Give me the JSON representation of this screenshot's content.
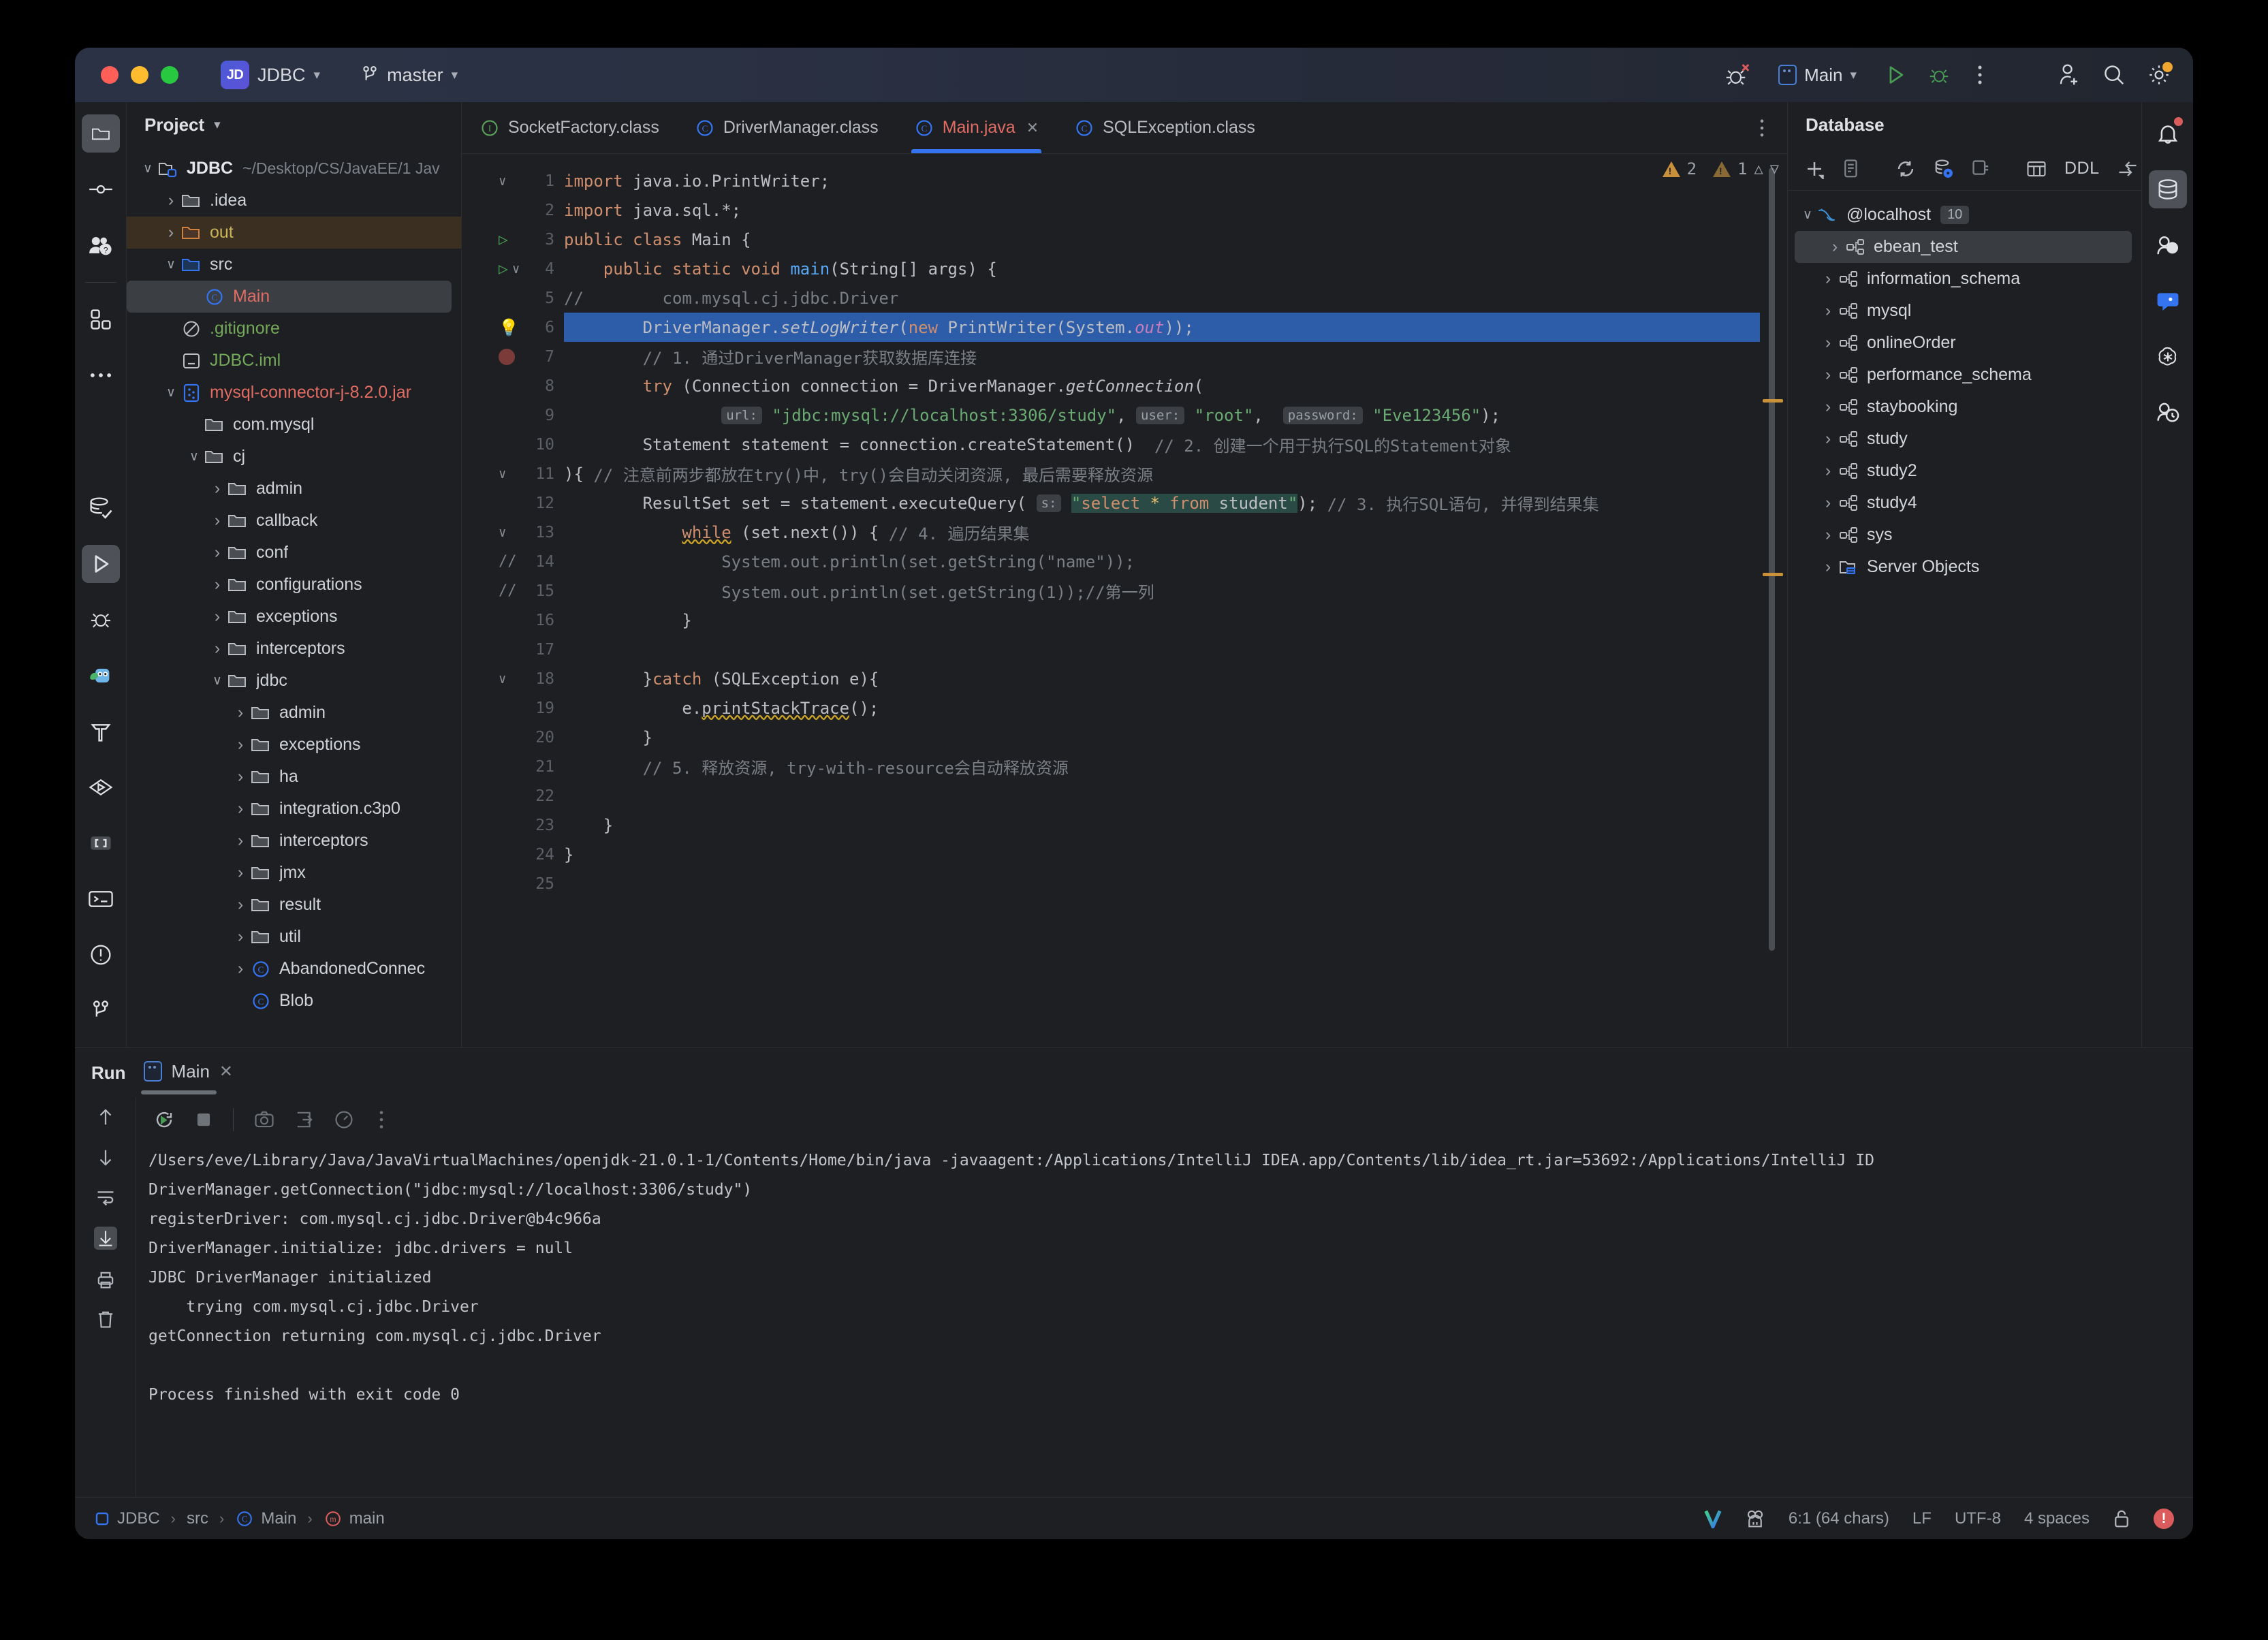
{
  "window": {
    "traffic": [
      "close",
      "minimize",
      "maximize"
    ],
    "project_badge": "JD",
    "project_name": "JDBC",
    "branch": "master",
    "run_config": "Main"
  },
  "activity_bar_left": [
    {
      "name": "project-icon",
      "label": "Project",
      "selected": true
    },
    {
      "name": "commit-icon",
      "label": "Commit"
    },
    {
      "name": "pull-requests-icon",
      "label": "Pull Requests"
    },
    {
      "name": "structure-icon",
      "label": "Structure"
    },
    {
      "name": "more-tool-windows-icon",
      "label": "More"
    }
  ],
  "activity_bar_left_bottom": [
    {
      "name": "database-check-icon",
      "label": "Database Changes"
    },
    {
      "name": "run-icon",
      "label": "Run",
      "selected": true
    },
    {
      "name": "debug-icon",
      "label": "Debug"
    },
    {
      "name": "ai-assistant-icon",
      "label": "AI Assistant"
    },
    {
      "name": "build-icon",
      "label": "Build"
    },
    {
      "name": "services-icon",
      "label": "Services"
    },
    {
      "name": "dependencies-icon",
      "label": "Dependencies"
    },
    {
      "name": "terminal-icon",
      "label": "Terminal"
    },
    {
      "name": "problems-icon",
      "label": "Problems"
    },
    {
      "name": "version-control-icon",
      "label": "Version Control"
    }
  ],
  "activity_bar_right": [
    {
      "name": "notifications-icon",
      "label": "Notifications",
      "dot": true
    },
    {
      "name": "database-icon",
      "label": "Database",
      "selected": true
    },
    {
      "name": "ai-chat-icon",
      "label": "AI Chat"
    },
    {
      "name": "assistant-icon",
      "label": "Assistant"
    },
    {
      "name": "openai-icon",
      "label": "OpenAI"
    },
    {
      "name": "profiler-icon",
      "label": "Profiler"
    }
  ],
  "project_panel": {
    "title": "Project",
    "items": [
      {
        "depth": 0,
        "arrow": "open",
        "icon": "module-folder",
        "label": "JDBC",
        "suffix": "~/Desktop/CS/JavaEE/1 Jav",
        "bold": true
      },
      {
        "depth": 1,
        "arrow": "closed",
        "icon": "folder",
        "label": ".idea"
      },
      {
        "depth": 1,
        "arrow": "closed",
        "icon": "folder-excluded",
        "label": "out",
        "color": "yellow",
        "highlight": true
      },
      {
        "depth": 1,
        "arrow": "open",
        "icon": "folder-source",
        "label": "src"
      },
      {
        "depth": 2,
        "arrow": "none",
        "icon": "class",
        "label": "Main",
        "color": "red",
        "selected": true
      },
      {
        "depth": 1,
        "arrow": "none",
        "icon": "gitignore",
        "label": ".gitignore",
        "color": "green"
      },
      {
        "depth": 1,
        "arrow": "none",
        "icon": "iml",
        "label": "JDBC.iml",
        "color": "green"
      },
      {
        "depth": 1,
        "arrow": "open",
        "icon": "jar",
        "label": "mysql-connector-j-8.2.0.jar",
        "color": "red"
      },
      {
        "depth": 2,
        "arrow": "none",
        "icon": "folder",
        "label": "com.mysql"
      },
      {
        "depth": 2,
        "arrow": "open",
        "icon": "folder",
        "label": "cj"
      },
      {
        "depth": 3,
        "arrow": "closed",
        "icon": "folder",
        "label": "admin"
      },
      {
        "depth": 3,
        "arrow": "closed",
        "icon": "folder",
        "label": "callback"
      },
      {
        "depth": 3,
        "arrow": "closed",
        "icon": "folder",
        "label": "conf"
      },
      {
        "depth": 3,
        "arrow": "closed",
        "icon": "folder",
        "label": "configurations"
      },
      {
        "depth": 3,
        "arrow": "closed",
        "icon": "folder",
        "label": "exceptions"
      },
      {
        "depth": 3,
        "arrow": "closed",
        "icon": "folder",
        "label": "interceptors"
      },
      {
        "depth": 3,
        "arrow": "open",
        "icon": "folder",
        "label": "jdbc"
      },
      {
        "depth": 4,
        "arrow": "closed",
        "icon": "folder",
        "label": "admin"
      },
      {
        "depth": 4,
        "arrow": "closed",
        "icon": "folder",
        "label": "exceptions"
      },
      {
        "depth": 4,
        "arrow": "closed",
        "icon": "folder",
        "label": "ha"
      },
      {
        "depth": 4,
        "arrow": "closed",
        "icon": "folder",
        "label": "integration.c3p0"
      },
      {
        "depth": 4,
        "arrow": "closed",
        "icon": "folder",
        "label": "interceptors"
      },
      {
        "depth": 4,
        "arrow": "closed",
        "icon": "folder",
        "label": "jmx"
      },
      {
        "depth": 4,
        "arrow": "closed",
        "icon": "folder",
        "label": "result"
      },
      {
        "depth": 4,
        "arrow": "closed",
        "icon": "folder",
        "label": "util"
      },
      {
        "depth": 4,
        "arrow": "closed",
        "icon": "class",
        "label": "AbandonedConnec"
      },
      {
        "depth": 4,
        "arrow": "none",
        "icon": "class",
        "label": "Blob"
      }
    ]
  },
  "editor": {
    "tabs": [
      {
        "label": "SocketFactory.class",
        "icon": "interface",
        "active": false
      },
      {
        "label": "DriverManager.class",
        "icon": "class",
        "active": false
      },
      {
        "label": "Main.java",
        "icon": "class",
        "active": true,
        "closable": true
      },
      {
        "label": "SQLException.class",
        "icon": "class",
        "active": false
      }
    ],
    "inspections": {
      "warnings": "2",
      "weak_warnings": "1"
    },
    "lines": [
      {
        "n": "1",
        "fold": "open",
        "code": [
          {
            "t": "import",
            "c": "kw"
          },
          {
            "t": " java.io.PrintWriter;",
            "c": "white"
          }
        ]
      },
      {
        "n": "2",
        "code": [
          {
            "t": "import",
            "c": "kw"
          },
          {
            "t": " java.sql.*;",
            "c": "white"
          }
        ]
      },
      {
        "n": "3",
        "run": true,
        "code": [
          {
            "t": "public class",
            "c": "kw"
          },
          {
            "t": " Main {",
            "c": "white"
          }
        ]
      },
      {
        "n": "4",
        "run": true,
        "fold": "open",
        "code": [
          {
            "t": "    ",
            "c": "white"
          },
          {
            "t": "public static void",
            "c": "kw"
          },
          {
            "t": " ",
            "c": "white"
          },
          {
            "t": "main",
            "c": "meth"
          },
          {
            "t": "(String[] args) {",
            "c": "white"
          }
        ]
      },
      {
        "n": "5",
        "code": [
          {
            "t": "//        com.mysql.cj.jdbc.Driver",
            "c": "cmt"
          }
        ]
      },
      {
        "n": "6",
        "bulb": true,
        "highlight": true,
        "code": [
          {
            "t": "        DriverManager.",
            "c": "white"
          },
          {
            "t": "setLogWriter",
            "c": "ital"
          },
          {
            "t": "(",
            "c": "white"
          },
          {
            "t": "new",
            "c": "kw"
          },
          {
            "t": " PrintWriter(System.",
            "c": "white"
          },
          {
            "t": "out",
            "c": "field ital"
          },
          {
            "t": "));",
            "c": "white"
          }
        ]
      },
      {
        "n": "7",
        "breakpoint": true,
        "code": [
          {
            "t": "        // 1. 通过DriverManager获取数据库连接",
            "c": "cmt"
          }
        ]
      },
      {
        "n": "8",
        "code": [
          {
            "t": "        ",
            "c": "white"
          },
          {
            "t": "try",
            "c": "kw"
          },
          {
            "t": " (Connection connection = DriverManager.",
            "c": "white"
          },
          {
            "t": "getConnection",
            "c": "ital"
          },
          {
            "t": "(",
            "c": "white"
          }
        ]
      },
      {
        "n": "9",
        "code": [
          {
            "t": "                ",
            "c": "white"
          },
          {
            "t": "url:",
            "c": "hint"
          },
          {
            "t": " ",
            "c": "white"
          },
          {
            "t": "\"jdbc:mysql://localhost:3306/study\"",
            "c": "str"
          },
          {
            "t": ", ",
            "c": "white"
          },
          {
            "t": "user:",
            "c": "hint"
          },
          {
            "t": " ",
            "c": "white"
          },
          {
            "t": "\"root\"",
            "c": "str"
          },
          {
            "t": ",  ",
            "c": "white"
          },
          {
            "t": "password:",
            "c": "hint"
          },
          {
            "t": " ",
            "c": "white"
          },
          {
            "t": "\"Eve123456\"",
            "c": "str"
          },
          {
            "t": ");",
            "c": "white"
          }
        ]
      },
      {
        "n": "10",
        "code": [
          {
            "t": "        Statement statement = connection.createStatement()  ",
            "c": "white"
          },
          {
            "t": "// 2. 创建一个用于执行SQL的Statement对象",
            "c": "cmt"
          }
        ]
      },
      {
        "n": "11",
        "fold": "open",
        "code": [
          {
            "t": "){ ",
            "c": "white"
          },
          {
            "t": "// 注意前两步都放在try()中, try()会自动关闭资源, 最后需要释放资源",
            "c": "cmt"
          }
        ]
      },
      {
        "n": "12",
        "code": [
          {
            "t": "        ResultSet set = statement.executeQuery( ",
            "c": "white"
          },
          {
            "t": "s:",
            "c": "hint"
          },
          {
            "t": " ",
            "c": "white"
          },
          {
            "t": "\"select * from student\"",
            "c": "sql"
          },
          {
            "t": "); ",
            "c": "white"
          },
          {
            "t": "// 3. 执行SQL语句, 并得到结果集",
            "c": "cmt"
          }
        ]
      },
      {
        "n": "13",
        "fold": "open",
        "code": [
          {
            "t": "            ",
            "c": "white"
          },
          {
            "t": "while",
            "c": "kw squig"
          },
          {
            "t": " (set.next()) { ",
            "c": "white"
          },
          {
            "t": "// 4. 遍历结果集",
            "c": "cmt"
          }
        ]
      },
      {
        "n": "14",
        "comment_gutter": true,
        "code": [
          {
            "t": "                System.out.println(set.getString(\"name\"));",
            "c": "cmt"
          }
        ]
      },
      {
        "n": "15",
        "comment_gutter": true,
        "code": [
          {
            "t": "                System.out.println(set.getString(1));//第一列",
            "c": "cmt"
          }
        ]
      },
      {
        "n": "16",
        "code": [
          {
            "t": "            }",
            "c": "white"
          }
        ]
      },
      {
        "n": "17",
        "code": [
          {
            "t": "",
            "c": "white"
          }
        ]
      },
      {
        "n": "18",
        "fold": "open",
        "code": [
          {
            "t": "        }",
            "c": "white"
          },
          {
            "t": "catch",
            "c": "kw"
          },
          {
            "t": " (SQLException e){",
            "c": "white"
          }
        ]
      },
      {
        "n": "19",
        "code": [
          {
            "t": "            e.",
            "c": "white"
          },
          {
            "t": "printStackTrace",
            "c": "squig"
          },
          {
            "t": "();",
            "c": "white"
          }
        ]
      },
      {
        "n": "20",
        "code": [
          {
            "t": "        }",
            "c": "white"
          }
        ]
      },
      {
        "n": "21",
        "code": [
          {
            "t": "        // 5. 释放资源, try-with-resource会自动释放资源",
            "c": "cmt"
          }
        ]
      },
      {
        "n": "22",
        "code": [
          {
            "t": "",
            "c": "white"
          }
        ]
      },
      {
        "n": "23",
        "code": [
          {
            "t": "    }",
            "c": "white"
          }
        ]
      },
      {
        "n": "24",
        "code": [
          {
            "t": "}",
            "c": "white"
          }
        ]
      },
      {
        "n": "25",
        "code": [
          {
            "t": "",
            "c": "white"
          }
        ]
      }
    ]
  },
  "database_panel": {
    "title": "Database",
    "toolbar": [
      "add-icon",
      "duplicate-icon",
      "refresh-icon",
      "db-settings-icon",
      "disconnect-icon",
      "table-icon",
      "DDL",
      "jump-to-icon",
      "expand-icon"
    ],
    "ddl_label": "DDL",
    "items": [
      {
        "depth": 0,
        "arrow": "open",
        "icon": "mysql",
        "label": "@localhost",
        "badge": "10"
      },
      {
        "depth": 1,
        "arrow": "closed",
        "icon": "schema",
        "label": "ebean_test",
        "selected": true
      },
      {
        "depth": 1,
        "arrow": "closed",
        "icon": "schema",
        "label": "information_schema"
      },
      {
        "depth": 1,
        "arrow": "closed",
        "icon": "schema",
        "label": "mysql"
      },
      {
        "depth": 1,
        "arrow": "closed",
        "icon": "schema",
        "label": "onlineOrder"
      },
      {
        "depth": 1,
        "arrow": "closed",
        "icon": "schema",
        "label": "performance_schema"
      },
      {
        "depth": 1,
        "arrow": "closed",
        "icon": "schema",
        "label": "staybooking"
      },
      {
        "depth": 1,
        "arrow": "closed",
        "icon": "schema",
        "label": "study"
      },
      {
        "depth": 1,
        "arrow": "closed",
        "icon": "schema",
        "label": "study2"
      },
      {
        "depth": 1,
        "arrow": "closed",
        "icon": "schema",
        "label": "study4"
      },
      {
        "depth": 1,
        "arrow": "closed",
        "icon": "schema",
        "label": "sys"
      },
      {
        "depth": 1,
        "arrow": "closed",
        "icon": "server-objects",
        "label": "Server Objects"
      }
    ]
  },
  "run_panel": {
    "title": "Run",
    "tab_label": "Main",
    "toolbar": [
      "rerun-icon",
      "stop-icon",
      "screenshot-icon",
      "export-icon",
      "profile-icon",
      "more-icon"
    ],
    "gutter": [
      "scroll-up-icon",
      "scroll-down-icon",
      "soft-wrap-icon",
      "scroll-to-end-icon",
      "print-icon",
      "clear-icon"
    ],
    "output": [
      "/Users/eve/Library/Java/JavaVirtualMachines/openjdk-21.0.1-1/Contents/Home/bin/java -javaagent:/Applications/IntelliJ IDEA.app/Contents/lib/idea_rt.jar=53692:/Applications/IntelliJ ID",
      "DriverManager.getConnection(\"jdbc:mysql://localhost:3306/study\")",
      "registerDriver: com.mysql.cj.jdbc.Driver@b4c966a",
      "DriverManager.initialize: jdbc.drivers = null",
      "JDBC DriverManager initialized",
      "    trying com.mysql.cj.jdbc.Driver",
      "getConnection returning com.mysql.cj.jdbc.Driver",
      "",
      "Process finished with exit code 0"
    ]
  },
  "status_bar": {
    "breadcrumb": [
      {
        "icon": "module",
        "label": "JDBC"
      },
      {
        "icon": "none",
        "label": "src"
      },
      {
        "icon": "class",
        "label": "Main"
      },
      {
        "icon": "method",
        "label": "main"
      }
    ],
    "right": [
      {
        "name": "vue-icon",
        "label": ""
      },
      {
        "name": "ide-agent-icon",
        "label": ""
      },
      {
        "name": "caret-position",
        "label": "6:1 (64 chars)"
      },
      {
        "name": "line-separator",
        "label": "LF"
      },
      {
        "name": "file-encoding",
        "label": "UTF-8"
      },
      {
        "name": "indent",
        "label": "4 spaces"
      },
      {
        "name": "readonly-toggle",
        "label": ""
      },
      {
        "name": "error-indicator",
        "label": "!"
      }
    ]
  },
  "colors": {
    "accent": "#3574f0",
    "bg": "#1e1f22",
    "panel": "#2b2d30",
    "error": "#db5c5c",
    "warning": "#c9923a"
  }
}
